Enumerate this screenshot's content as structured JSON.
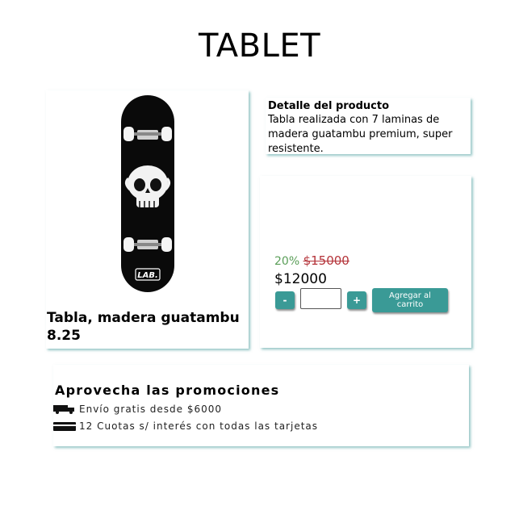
{
  "page": {
    "title": "TABLET"
  },
  "product": {
    "name": "Tabla, madera guatambu 8.25",
    "image_brand": "LAB."
  },
  "detail": {
    "heading": "Detalle del producto",
    "text": "Tabla realizada con 7 laminas de madera guatambu premium, super resistente."
  },
  "purchase": {
    "discount": "20%",
    "old_price": "$15000",
    "new_price": "$12000",
    "minus_label": "-",
    "plus_label": "+",
    "quantity_value": "",
    "add_to_cart_label": "Agregar al carrito"
  },
  "promo": {
    "heading": "Aprovecha las promociones",
    "items": [
      {
        "icon": "truck-icon",
        "text": "Envío gratis desde $6000"
      },
      {
        "icon": "credit-card-icon",
        "text": "12 Cuotas s/ interés con todas las tarjetas"
      }
    ]
  },
  "colors": {
    "accent": "#3a9a96",
    "discount": "#5a9e58",
    "old_price": "#b5353b"
  }
}
